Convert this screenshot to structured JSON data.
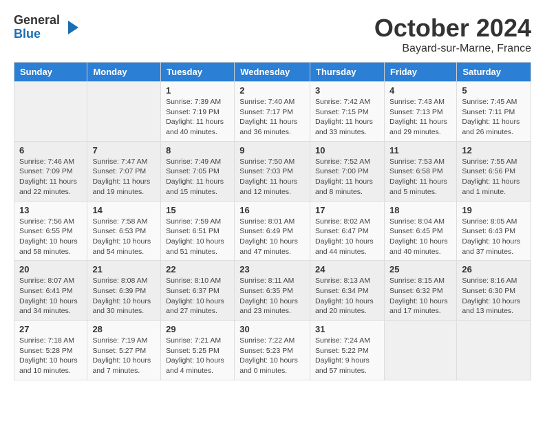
{
  "logo": {
    "general": "General",
    "blue": "Blue"
  },
  "title": {
    "month": "October 2024",
    "location": "Bayard-sur-Marne, France"
  },
  "days_of_week": [
    "Sunday",
    "Monday",
    "Tuesday",
    "Wednesday",
    "Thursday",
    "Friday",
    "Saturday"
  ],
  "weeks": [
    [
      {
        "day": null
      },
      {
        "day": null
      },
      {
        "day": "1",
        "sunrise": "Sunrise: 7:39 AM",
        "sunset": "Sunset: 7:19 PM",
        "daylight": "Daylight: 11 hours and 40 minutes."
      },
      {
        "day": "2",
        "sunrise": "Sunrise: 7:40 AM",
        "sunset": "Sunset: 7:17 PM",
        "daylight": "Daylight: 11 hours and 36 minutes."
      },
      {
        "day": "3",
        "sunrise": "Sunrise: 7:42 AM",
        "sunset": "Sunset: 7:15 PM",
        "daylight": "Daylight: 11 hours and 33 minutes."
      },
      {
        "day": "4",
        "sunrise": "Sunrise: 7:43 AM",
        "sunset": "Sunset: 7:13 PM",
        "daylight": "Daylight: 11 hours and 29 minutes."
      },
      {
        "day": "5",
        "sunrise": "Sunrise: 7:45 AM",
        "sunset": "Sunset: 7:11 PM",
        "daylight": "Daylight: 11 hours and 26 minutes."
      }
    ],
    [
      {
        "day": "6",
        "sunrise": "Sunrise: 7:46 AM",
        "sunset": "Sunset: 7:09 PM",
        "daylight": "Daylight: 11 hours and 22 minutes."
      },
      {
        "day": "7",
        "sunrise": "Sunrise: 7:47 AM",
        "sunset": "Sunset: 7:07 PM",
        "daylight": "Daylight: 11 hours and 19 minutes."
      },
      {
        "day": "8",
        "sunrise": "Sunrise: 7:49 AM",
        "sunset": "Sunset: 7:05 PM",
        "daylight": "Daylight: 11 hours and 15 minutes."
      },
      {
        "day": "9",
        "sunrise": "Sunrise: 7:50 AM",
        "sunset": "Sunset: 7:03 PM",
        "daylight": "Daylight: 11 hours and 12 minutes."
      },
      {
        "day": "10",
        "sunrise": "Sunrise: 7:52 AM",
        "sunset": "Sunset: 7:00 PM",
        "daylight": "Daylight: 11 hours and 8 minutes."
      },
      {
        "day": "11",
        "sunrise": "Sunrise: 7:53 AM",
        "sunset": "Sunset: 6:58 PM",
        "daylight": "Daylight: 11 hours and 5 minutes."
      },
      {
        "day": "12",
        "sunrise": "Sunrise: 7:55 AM",
        "sunset": "Sunset: 6:56 PM",
        "daylight": "Daylight: 11 hours and 1 minute."
      }
    ],
    [
      {
        "day": "13",
        "sunrise": "Sunrise: 7:56 AM",
        "sunset": "Sunset: 6:55 PM",
        "daylight": "Daylight: 10 hours and 58 minutes."
      },
      {
        "day": "14",
        "sunrise": "Sunrise: 7:58 AM",
        "sunset": "Sunset: 6:53 PM",
        "daylight": "Daylight: 10 hours and 54 minutes."
      },
      {
        "day": "15",
        "sunrise": "Sunrise: 7:59 AM",
        "sunset": "Sunset: 6:51 PM",
        "daylight": "Daylight: 10 hours and 51 minutes."
      },
      {
        "day": "16",
        "sunrise": "Sunrise: 8:01 AM",
        "sunset": "Sunset: 6:49 PM",
        "daylight": "Daylight: 10 hours and 47 minutes."
      },
      {
        "day": "17",
        "sunrise": "Sunrise: 8:02 AM",
        "sunset": "Sunset: 6:47 PM",
        "daylight": "Daylight: 10 hours and 44 minutes."
      },
      {
        "day": "18",
        "sunrise": "Sunrise: 8:04 AM",
        "sunset": "Sunset: 6:45 PM",
        "daylight": "Daylight: 10 hours and 40 minutes."
      },
      {
        "day": "19",
        "sunrise": "Sunrise: 8:05 AM",
        "sunset": "Sunset: 6:43 PM",
        "daylight": "Daylight: 10 hours and 37 minutes."
      }
    ],
    [
      {
        "day": "20",
        "sunrise": "Sunrise: 8:07 AM",
        "sunset": "Sunset: 6:41 PM",
        "daylight": "Daylight: 10 hours and 34 minutes."
      },
      {
        "day": "21",
        "sunrise": "Sunrise: 8:08 AM",
        "sunset": "Sunset: 6:39 PM",
        "daylight": "Daylight: 10 hours and 30 minutes."
      },
      {
        "day": "22",
        "sunrise": "Sunrise: 8:10 AM",
        "sunset": "Sunset: 6:37 PM",
        "daylight": "Daylight: 10 hours and 27 minutes."
      },
      {
        "day": "23",
        "sunrise": "Sunrise: 8:11 AM",
        "sunset": "Sunset: 6:35 PM",
        "daylight": "Daylight: 10 hours and 23 minutes."
      },
      {
        "day": "24",
        "sunrise": "Sunrise: 8:13 AM",
        "sunset": "Sunset: 6:34 PM",
        "daylight": "Daylight: 10 hours and 20 minutes."
      },
      {
        "day": "25",
        "sunrise": "Sunrise: 8:15 AM",
        "sunset": "Sunset: 6:32 PM",
        "daylight": "Daylight: 10 hours and 17 minutes."
      },
      {
        "day": "26",
        "sunrise": "Sunrise: 8:16 AM",
        "sunset": "Sunset: 6:30 PM",
        "daylight": "Daylight: 10 hours and 13 minutes."
      }
    ],
    [
      {
        "day": "27",
        "sunrise": "Sunrise: 7:18 AM",
        "sunset": "Sunset: 5:28 PM",
        "daylight": "Daylight: 10 hours and 10 minutes."
      },
      {
        "day": "28",
        "sunrise": "Sunrise: 7:19 AM",
        "sunset": "Sunset: 5:27 PM",
        "daylight": "Daylight: 10 hours and 7 minutes."
      },
      {
        "day": "29",
        "sunrise": "Sunrise: 7:21 AM",
        "sunset": "Sunset: 5:25 PM",
        "daylight": "Daylight: 10 hours and 4 minutes."
      },
      {
        "day": "30",
        "sunrise": "Sunrise: 7:22 AM",
        "sunset": "Sunset: 5:23 PM",
        "daylight": "Daylight: 10 hours and 0 minutes."
      },
      {
        "day": "31",
        "sunrise": "Sunrise: 7:24 AM",
        "sunset": "Sunset: 5:22 PM",
        "daylight": "Daylight: 9 hours and 57 minutes."
      },
      {
        "day": null
      },
      {
        "day": null
      }
    ]
  ]
}
